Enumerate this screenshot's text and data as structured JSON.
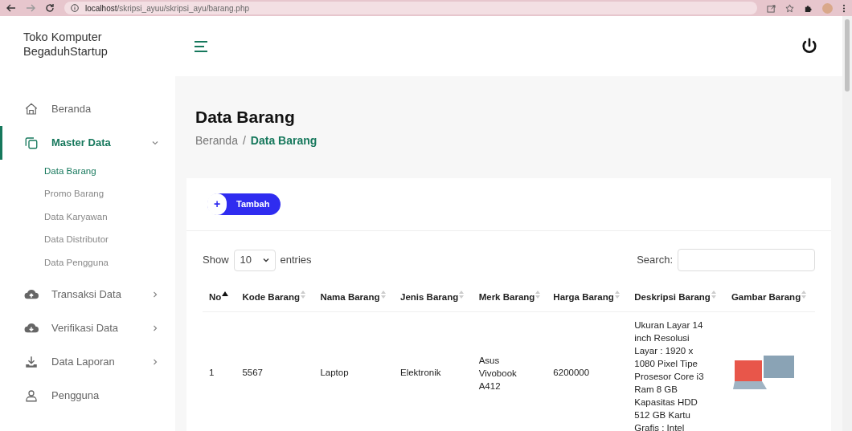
{
  "browser": {
    "url_host": "localhost",
    "url_path": "/skripsi_ayuu/skripsi_ayu/barang.php"
  },
  "sidebar": {
    "brand": "Toko Komputer BegaduhStartup",
    "items": [
      {
        "label": "Beranda",
        "kind": "home",
        "selected": false
      },
      {
        "label": "Master Data",
        "kind": "copy",
        "selected": true,
        "expanded": true,
        "children": [
          {
            "label": "Data Barang",
            "selected": true
          },
          {
            "label": "Promo Barang",
            "selected": false
          },
          {
            "label": "Data Karyawan",
            "selected": false
          },
          {
            "label": "Data Distributor",
            "selected": false
          },
          {
            "label": "Data Pengguna",
            "selected": false
          }
        ]
      },
      {
        "label": "Transaksi Data",
        "kind": "upload",
        "selected": false,
        "expanded": false
      },
      {
        "label": "Verifikasi Data",
        "kind": "download",
        "selected": false,
        "expanded": false
      },
      {
        "label": "Data Laporan",
        "kind": "tray",
        "selected": false,
        "expanded": false
      },
      {
        "label": "Pengguna",
        "kind": "user",
        "selected": false
      }
    ]
  },
  "page": {
    "title": "Data Barang",
    "breadcrumb": [
      {
        "label": "Beranda",
        "selected": false
      },
      {
        "label": "Data Barang",
        "selected": true
      }
    ],
    "separator": "/"
  },
  "card": {
    "add_button": {
      "icon": "+",
      "label": "Tambah"
    },
    "show_label": "Show",
    "entries_value": "10",
    "entries_label": "entries",
    "search_label": "Search:",
    "table": {
      "columns": [
        {
          "label": "No",
          "sorted": true
        },
        {
          "label": "Kode Barang",
          "sorted": false
        },
        {
          "label": "Nama Barang",
          "sorted": false
        },
        {
          "label": "Jenis Barang",
          "sorted": false
        },
        {
          "label": "Merk Barang",
          "sorted": false
        },
        {
          "label": "Harga Barang",
          "sorted": false
        },
        {
          "label": "Deskripsi Barang",
          "sorted": false
        },
        {
          "label": "Gambar Barang",
          "sorted": false
        }
      ],
      "rows": [
        {
          "no": "1",
          "kode": "5567",
          "nama": "Laptop",
          "jenis": "Elektronik",
          "merk": "Asus Vivobook A412",
          "harga": "6200000",
          "deskripsi": "Ukuran Layar 14 inch Resolusi Layar : 1920 x 1080 Pixel Tipe Prosesor Core i3 Ram 8 GB Kapasitas HDD 512 GB Kartu Grafis : Intel"
        }
      ]
    }
  }
}
